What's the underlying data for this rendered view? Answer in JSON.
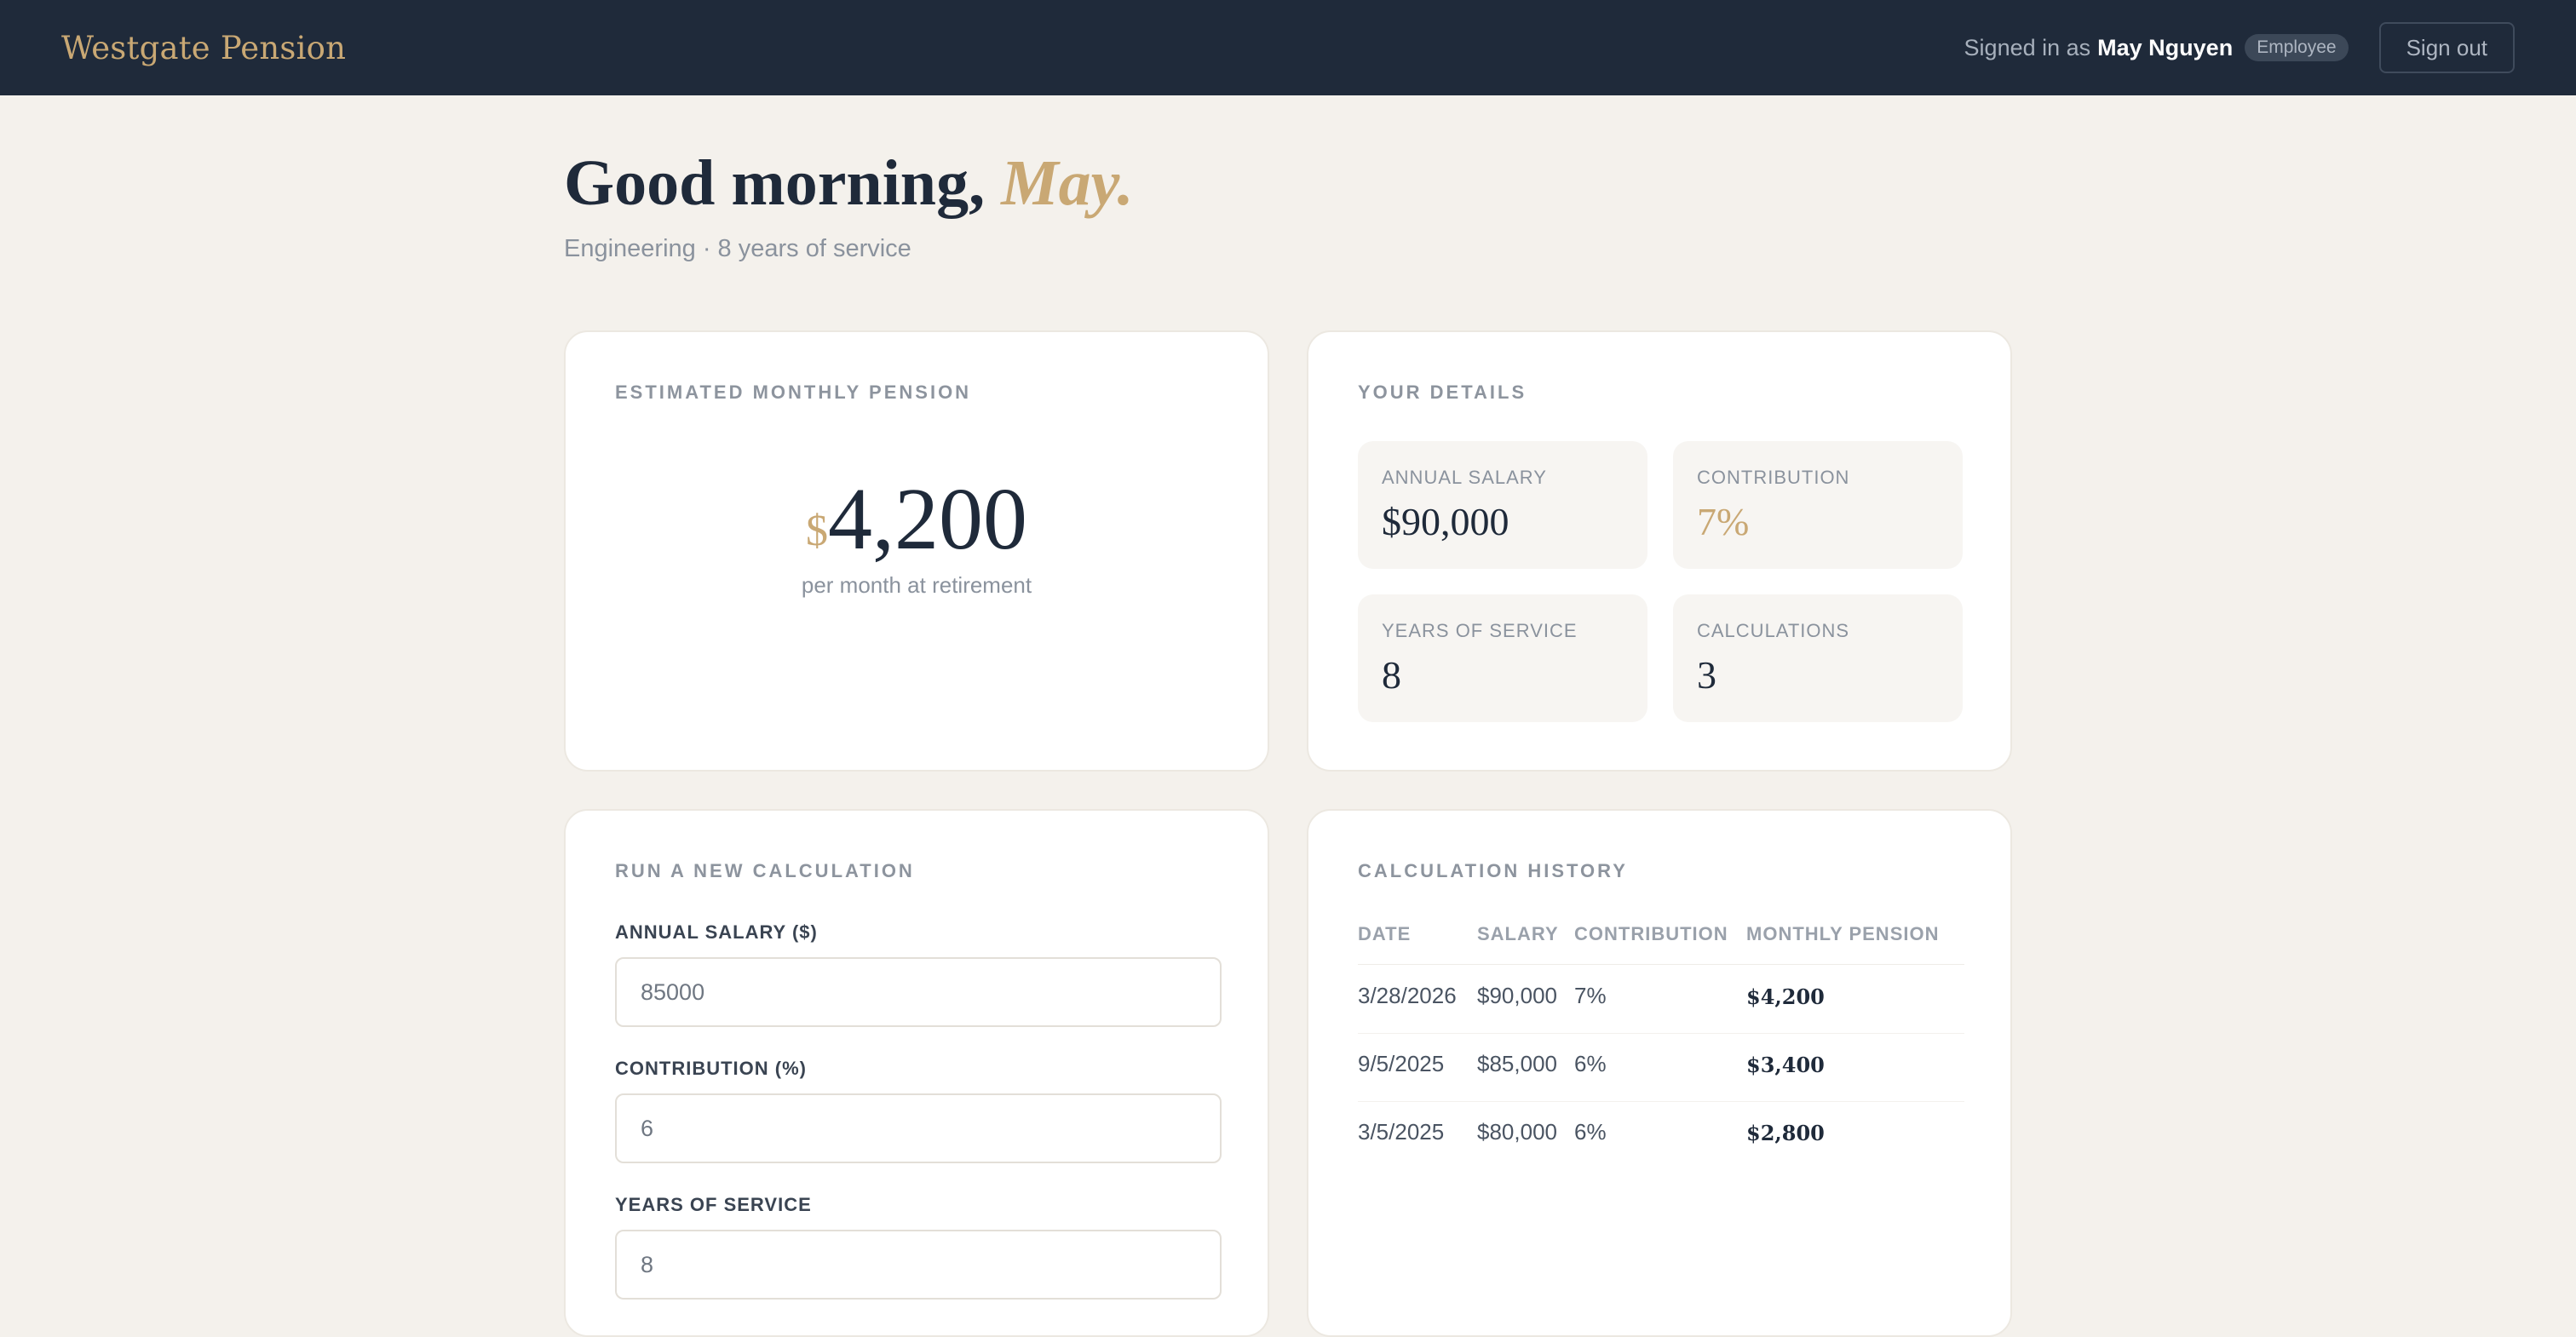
{
  "header": {
    "brand": "Westgate Pension",
    "signed_in_prefix": "Signed in as",
    "user_name": "May Nguyen",
    "role": "Employee",
    "sign_out": "Sign out"
  },
  "greeting": {
    "prefix": "Good morning,",
    "name": "May.",
    "subtitle": "Engineering · 8 years of service"
  },
  "pension_card": {
    "title": "ESTIMATED MONTHLY PENSION",
    "currency": "$",
    "amount": "4,200",
    "caption": "per month at retirement"
  },
  "details_card": {
    "title": "YOUR DETAILS",
    "stats": [
      {
        "label": "ANNUAL SALARY",
        "value": "$90,000"
      },
      {
        "label": "CONTRIBUTION",
        "value": "7%"
      },
      {
        "label": "YEARS OF SERVICE",
        "value": "8"
      },
      {
        "label": "CALCULATIONS",
        "value": "3"
      }
    ]
  },
  "calc_form": {
    "title": "RUN A NEW CALCULATION",
    "fields": [
      {
        "label": "ANNUAL SALARY ($)",
        "value": "85000"
      },
      {
        "label": "CONTRIBUTION (%)",
        "value": "6"
      },
      {
        "label": "YEARS OF SERVICE",
        "value": "8"
      }
    ]
  },
  "history": {
    "title": "CALCULATION HISTORY",
    "columns": [
      "DATE",
      "SALARY",
      "CONTRIBUTION",
      "MONTHLY PENSION"
    ],
    "rows": [
      {
        "date": "3/28/2026",
        "salary": "$90,000",
        "contribution": "7%",
        "pension": "$4,200"
      },
      {
        "date": "9/5/2025",
        "salary": "$85,000",
        "contribution": "6%",
        "pension": "$3,400"
      },
      {
        "date": "3/5/2025",
        "salary": "$80,000",
        "contribution": "6%",
        "pension": "$2,800"
      }
    ]
  },
  "colors": {
    "nav_bg": "#1f2a3a",
    "accent_gold": "#c9a874",
    "page_bg": "#f4f1ec"
  }
}
